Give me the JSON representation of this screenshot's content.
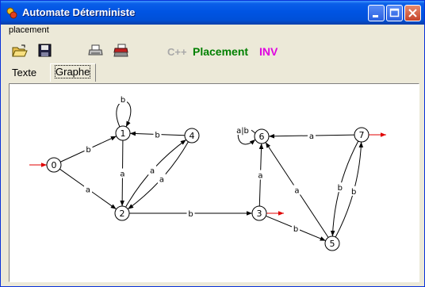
{
  "window": {
    "title": "Automate Déterministe"
  },
  "menu": {
    "items": [
      "placement"
    ]
  },
  "toolbar": {
    "icons": [
      "open-folder-icon",
      "save-icon",
      "print-icon",
      "print-setup-icon"
    ],
    "cpp_label": "C++",
    "placement_label": "Placement",
    "inv_label": "INV"
  },
  "tabs": [
    {
      "label": "Texte",
      "active": false
    },
    {
      "label": "Graphe",
      "active": true
    }
  ],
  "graph": {
    "states": [
      {
        "id": "0",
        "initial": true,
        "final": false
      },
      {
        "id": "1",
        "initial": false,
        "final": false
      },
      {
        "id": "2",
        "initial": false,
        "final": false
      },
      {
        "id": "3",
        "initial": false,
        "final": true
      },
      {
        "id": "4",
        "initial": false,
        "final": false
      },
      {
        "id": "5",
        "initial": false,
        "final": false
      },
      {
        "id": "6",
        "initial": false,
        "final": false
      },
      {
        "id": "7",
        "initial": true,
        "final": false
      }
    ],
    "transitions": [
      {
        "from": "0",
        "to": "1",
        "label": "b"
      },
      {
        "from": "0",
        "to": "2",
        "label": "a"
      },
      {
        "from": "1",
        "to": "1",
        "label": "b"
      },
      {
        "from": "1",
        "to": "2",
        "label": "a"
      },
      {
        "from": "4",
        "to": "1",
        "label": "b"
      },
      {
        "from": "2",
        "to": "4",
        "label": "a"
      },
      {
        "from": "4",
        "to": "2",
        "label": "a"
      },
      {
        "from": "2",
        "to": "3",
        "label": "b"
      },
      {
        "from": "3",
        "to": "6",
        "label": "a"
      },
      {
        "from": "3",
        "to": "5",
        "label": "b"
      },
      {
        "from": "6",
        "to": "6",
        "label": "a|b"
      },
      {
        "from": "7",
        "to": "6",
        "label": "a"
      },
      {
        "from": "5",
        "to": "6",
        "label": "a"
      },
      {
        "from": "7",
        "to": "5",
        "label": "b"
      },
      {
        "from": "5",
        "to": "7",
        "label": "b"
      }
    ],
    "colors": {
      "node_stroke": "#000000",
      "start_arrow": "#e00000"
    }
  }
}
